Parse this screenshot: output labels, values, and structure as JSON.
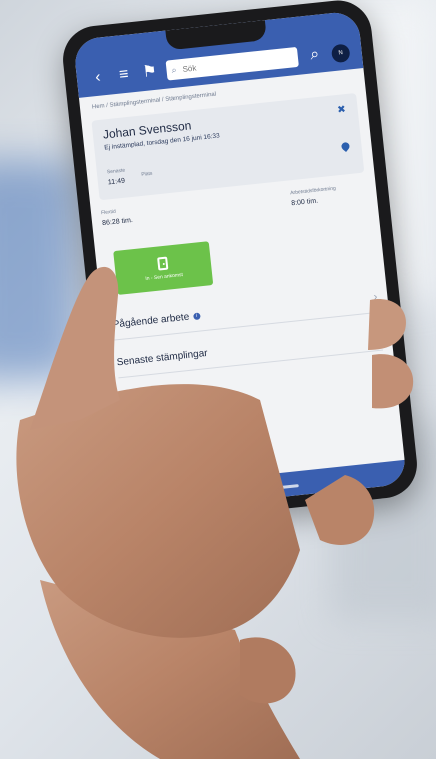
{
  "topbar": {
    "back_icon": "chevron-left-icon",
    "menu_icon": "menu-icon",
    "flag_icon": "flag-icon",
    "search_placeholder": "Sök",
    "avatar_text": "N"
  },
  "breadcrumb": "Hem / Stämplingsterminal / Stämplingsterminal",
  "card": {
    "name": "Johan Svensson",
    "status": "Ej instämplad, torsdag den 16 juni 16:33",
    "time_label": "Senaste",
    "time_value": "11:49",
    "place_label": "Plats"
  },
  "stats": {
    "flex_label": "Flextid",
    "flex_value": "86:28 tim.",
    "work_label": "Arbetstidsförkortning",
    "work_value": "8:00 tim."
  },
  "stamp_button": {
    "label": "In - Sen ankomst"
  },
  "rows": [
    {
      "label": "Pågående arbete"
    },
    {
      "label": "Senaste stämplingar"
    }
  ],
  "colors": {
    "brand": "#3a5fb0",
    "stamp_green": "#6cc24a"
  }
}
